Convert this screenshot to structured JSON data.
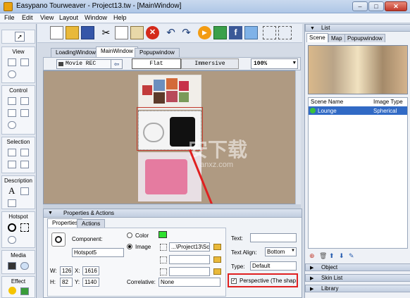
{
  "window": {
    "title": "Easypano Tourweaver - Project13.tw - [MainWindow]",
    "min_label": "–",
    "max_label": "□",
    "close_label": "✕"
  },
  "menu": [
    "File",
    "Edit",
    "View",
    "Layout",
    "Window",
    "Help"
  ],
  "toolbox": {
    "sections": [
      "View",
      "Control",
      "Selection",
      "Description",
      "Hotspot",
      "Media",
      "Effect"
    ]
  },
  "doc_tabs": [
    "LoadingWindow",
    "MainWindow",
    "Popupwindow"
  ],
  "canvas_toolbar": {
    "movie_rec": "Movie REC",
    "flat": "Flat",
    "immersive": "Immersive",
    "zoom": "100%"
  },
  "watermark": {
    "text": "安下载",
    "sub": "anxz.com"
  },
  "properties": {
    "panel_title": "Properties & Actions",
    "tabs": [
      "Properties",
      "Actions"
    ],
    "component_label": "Component:",
    "component_value": "Hotspot5",
    "w_label": "W:",
    "w_value": "126",
    "x_label": "X:",
    "x_value": "1616",
    "h_label": "H:",
    "h_value": "82",
    "y_label": "Y:",
    "y_value": "1140",
    "color_label": "Color",
    "image_label": "Image",
    "image_path": "...\\Project13\\Sc",
    "correlative_label": "Correlative:",
    "correlative_value": "None",
    "text_label": "Text:",
    "text_value": "",
    "text_align_label": "Text Align:",
    "text_align_value": "Bottom",
    "type_label": "Type:",
    "type_value": "Default",
    "perspective_label": "Perspective (The shape"
  },
  "right_panel": {
    "list_title": "List",
    "tabs": [
      "Scene",
      "Map",
      "Popupwindow"
    ],
    "col_scene_name": "Scene Name",
    "col_image_type": "Image Type",
    "rows": [
      {
        "name": "Lounge",
        "type": "Spherical"
      }
    ],
    "sections": [
      "Object",
      "Skin List",
      "Library"
    ]
  },
  "colors": {
    "accent": "#316ac5",
    "canvas": "#af9a82",
    "highlight_box": "#e02020",
    "color_swatch": "#2fe02f"
  }
}
